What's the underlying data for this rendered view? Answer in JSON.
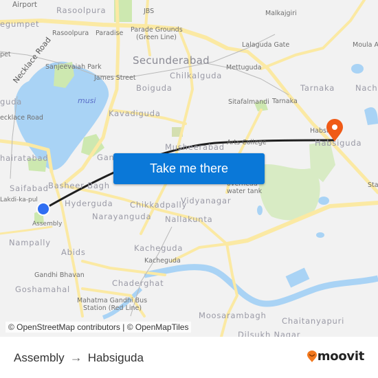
{
  "map": {
    "labels": {
      "airport": "Airport",
      "rasoolpura_area": "Rasoolpura",
      "jbs": "JBS",
      "malkajgiri": "Malkajgiri",
      "begumpet": "egumpet",
      "rasoolpura": "Rasoolpura",
      "paradise": "Paradise",
      "parade_grounds": "Parade Grounds",
      "green_line": "(Green Line)",
      "lalaguda_gate": "Lalaguda Gate",
      "moula_ali": "Moula Ali",
      "necklace_road_rot": "Necklace Road",
      "secunderabad": "Secunderabad",
      "sanjeevaiah_park": "Sanjeevaiah Park",
      "mettuguda": "Mettuguda",
      "james_street": "James Street",
      "pet": "pet",
      "boiguda": "Boiguda",
      "chilkalguda": "Chilkalguda",
      "tarnaka_area": "Tarnaka",
      "nacharam": "Nacha",
      "musi": "musi",
      "guda": "guda",
      "sitafalmandi": "Sitafalmandi",
      "tarnaka": "Tarnaka",
      "necklace_road": "ecklace Road",
      "kavadiguda": "Kavadiguda",
      "habsiguda_station": "Habsi",
      "habsiguda_area": "Habsiguda",
      "arts_college": "Arts College",
      "musheerabad": "Musheerabad",
      "khairatabad": "hairatabad",
      "gandhi_nagar": "Gand",
      "saifabad": "Saifabad",
      "basheer_bagh": "Basheer Bagh",
      "overhead_water_tank_1": "overhead",
      "overhead_water_tank_2": "water tank",
      "stadium": "Stac",
      "lakdi_ka_pul": "Lakdi-ka-pul",
      "hyderguda": "Hyderguda",
      "chikkadpally": "Chikkadpally",
      "vidyanagar": "Vidyanagar",
      "assembly": "Assembly",
      "narayanguda": "Narayanguda",
      "nallakunta": "Nallakunta",
      "nampally": "Nampally",
      "abids": "Abids",
      "kacheguda_area": "Kacheguda",
      "kacheguda_station": "Kacheguda",
      "gandhi_bhavan": "Gandhi Bhavan",
      "chaderghat": "Chaderghat",
      "goshamahal": "Goshamahal",
      "mgbs_1": "Mahatma Gandhi Bus",
      "mgbs_2": "Station (Red Line)",
      "moosarambagh": "Moosarambagh",
      "chaitanyapuri": "Chaitanyapuri",
      "dilsukh_nagar": "Dilsukh Nagar"
    },
    "cta_label": "Take me there",
    "attribution": "© OpenStreetMap contributors | © OpenMapTiles",
    "colors": {
      "water": "#a9d3f5",
      "park": "#cde8b0",
      "road": "#fbe9a3",
      "route": "#1f1f1f",
      "origin": "#2f6ef2",
      "destination": "#f05a16",
      "cta": "#0a78d8"
    }
  },
  "footer": {
    "origin": "Assembly",
    "arrow_icon": "→",
    "destination": "Habsiguda",
    "brand": "moovit",
    "brand_color": "#f2781e"
  }
}
